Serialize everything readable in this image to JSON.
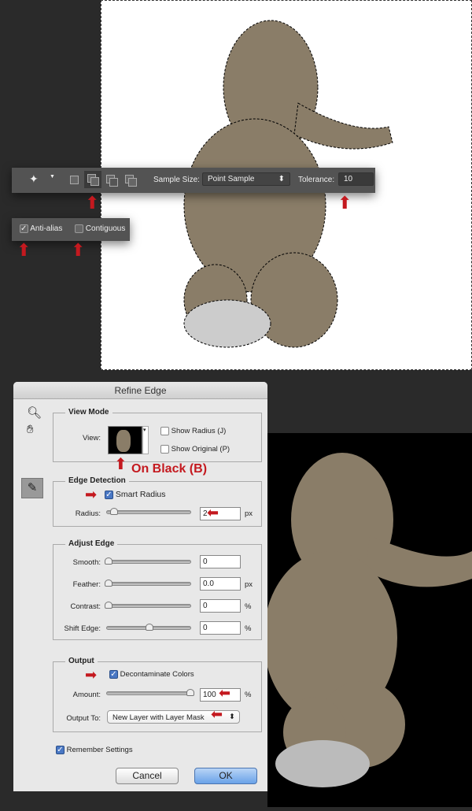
{
  "toolbar": {
    "sample_size_label": "Sample Size:",
    "sample_size_value": "Point Sample",
    "tolerance_label": "Tolerance:",
    "tolerance_value": "10"
  },
  "options": {
    "anti_alias_label": "Anti-alias",
    "anti_alias_checked": true,
    "contiguous_label": "Contiguous",
    "contiguous_checked": false
  },
  "dialog": {
    "title": "Refine Edge",
    "view_mode": {
      "legend": "View Mode",
      "view_label": "View:",
      "show_radius": "Show Radius (J)",
      "show_original": "Show Original (P)",
      "annotation": "On Black (B)"
    },
    "edge_detection": {
      "legend": "Edge Detection",
      "smart_radius": "Smart Radius",
      "radius_label": "Radius:",
      "radius_value": "2",
      "radius_unit": "px"
    },
    "adjust_edge": {
      "legend": "Adjust Edge",
      "smooth_label": "Smooth:",
      "smooth_value": "0",
      "feather_label": "Feather:",
      "feather_value": "0.0",
      "feather_unit": "px",
      "contrast_label": "Contrast:",
      "contrast_value": "0",
      "contrast_unit": "%",
      "shift_label": "Shift Edge:",
      "shift_value": "0",
      "shift_unit": "%"
    },
    "output": {
      "legend": "Output",
      "decontaminate": "Decontaminate Colors",
      "amount_label": "Amount:",
      "amount_value": "100",
      "amount_unit": "%",
      "output_to_label": "Output To:",
      "output_to_value": "New Layer with Layer Mask"
    },
    "remember": "Remember Settings",
    "cancel": "Cancel",
    "ok": "OK"
  },
  "colors": {
    "arrow": "#c4191f",
    "panel": "#535353"
  }
}
